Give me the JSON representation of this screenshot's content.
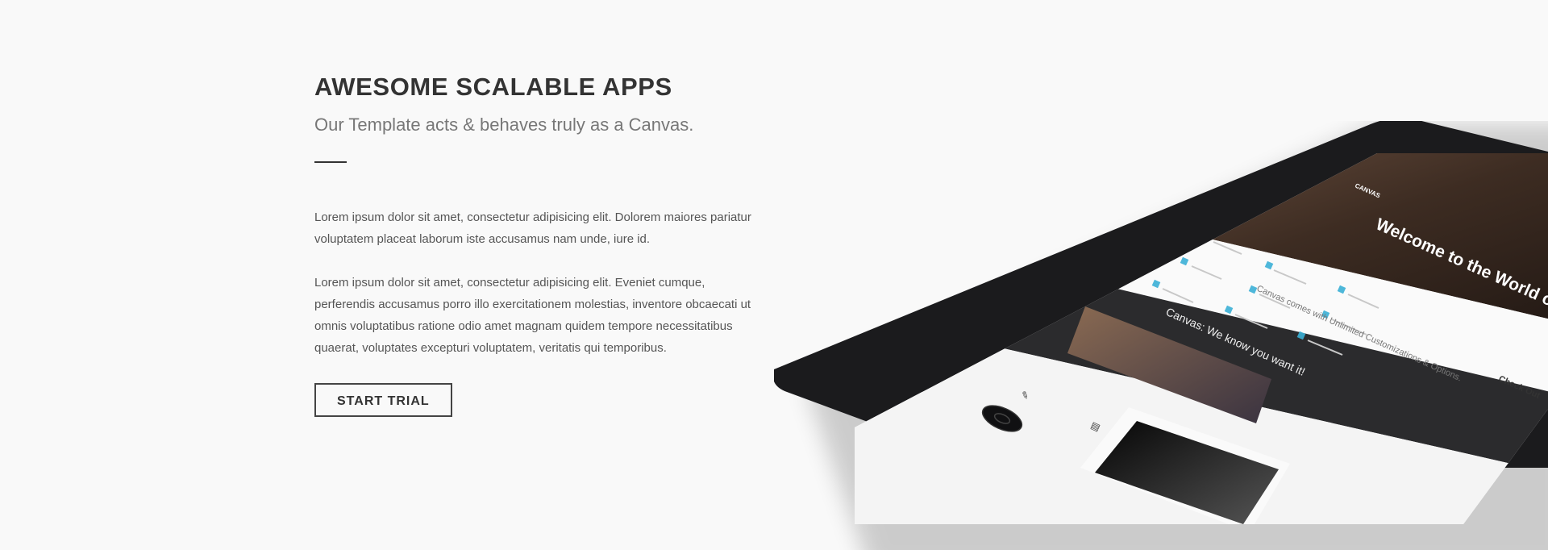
{
  "section": {
    "heading": "AWESOME SCALABLE APPS",
    "subheading": "Our Template acts & behaves truly as a Canvas.",
    "paragraphs": [
      "Lorem ipsum dolor sit amet, consectetur adipisicing elit. Dolorem maiores pariatur voluptatem placeat laborum iste accusamus nam unde, iure id.",
      "Lorem ipsum dolor sit amet, consectetur adipisicing elit. Eveniet cumque, perferendis accusamus porro illo exercitationem molestias, inventore obcaecati ut omnis voluptatibus ratione odio amet magnam quidem tempore necessitatibus quaerat, voluptates excepturi voluptatem, veritatis qui temporibus."
    ],
    "button_label": "START TRIAL"
  },
  "tablet_screen": {
    "logo": "CANVAS",
    "hero_title": "Welcome to the World of",
    "features_title": "Canvas comes with Unlimited Customizations & Options.",
    "features_link": "Check Out",
    "dark_title": "Canvas: We know you want it!"
  },
  "colors": {
    "background": "#f9f9f9",
    "text_dark": "#333333",
    "text_muted": "#777777",
    "tablet_frame": "#1b1b1d"
  }
}
